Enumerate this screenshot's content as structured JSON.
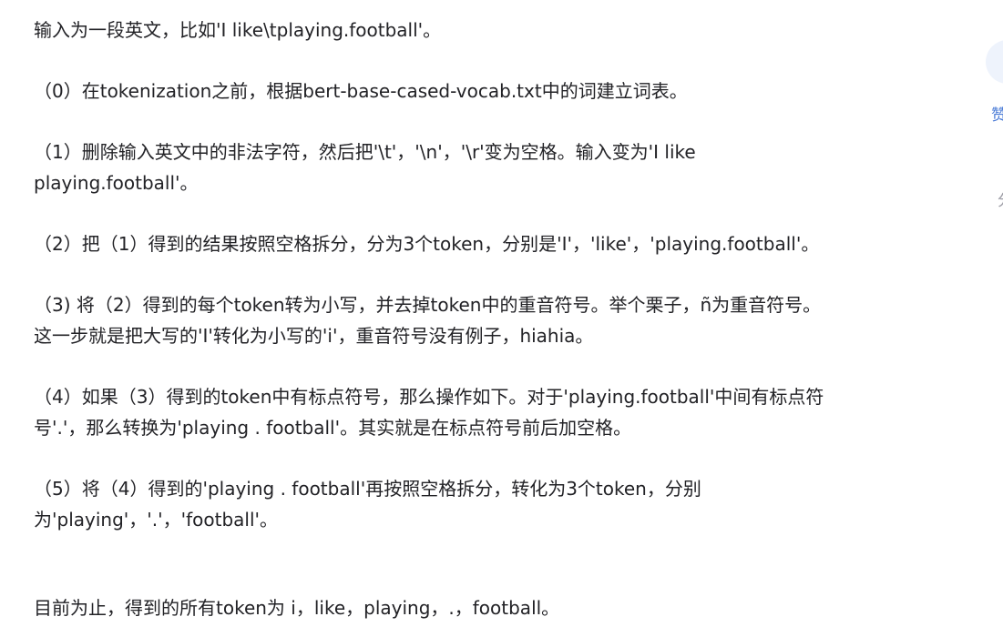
{
  "article": {
    "paragraphs": [
      {
        "lines": [
          "输入为一段英文，比如'I like\\tplaying.football'。"
        ]
      },
      {
        "lines": [
          "（0）在tokenization之前，根据bert-base-cased-vocab.txt中的词建立词表。"
        ]
      },
      {
        "lines": [
          "（1）删除输入英文中的非法字符，然后把'\\t'，'\\n'，'\\r'变为空格。输入变为'I like",
          "playing.football'。"
        ]
      },
      {
        "lines": [
          "（2）把（1）得到的结果按照空格拆分，分为3个token，分别是'I'，'like'，'playing.football'。"
        ]
      },
      {
        "lines": [
          "（3) 将（2）得到的每个token转为小写，并去掉token中的重音符号。举个栗子，ñ为重音符号。",
          "这一步就是把大写的'I'转化为小写的'i'，重音符号没有例子，hiahia。"
        ]
      },
      {
        "lines": [
          "（4）如果（3）得到的token中有标点符号，那么操作如下。对于'playing.football'中间有标点符",
          "号'.'，那么转换为'playing . football'。其实就是在标点符号前后加空格。"
        ]
      },
      {
        "lines": [
          "（5）将（4）得到的'playing . football'再按照空格拆分，转化为3个token，分别",
          "为'playing'，'.'，'football'。"
        ]
      },
      {
        "lines": [
          "目前为止，得到的所有token为 i，like，playing，.，football。"
        ]
      }
    ]
  },
  "sidebar": {
    "like_label": "赞",
    "share_label": "分"
  }
}
